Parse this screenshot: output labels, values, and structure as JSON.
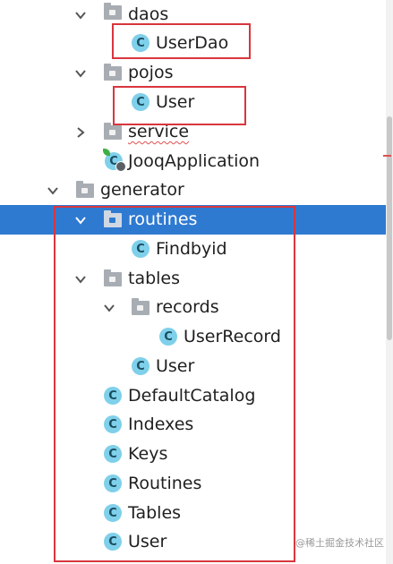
{
  "tree": {
    "daos": "daos",
    "userdao": "UserDao",
    "pojos": "pojos",
    "user_pojo": "User",
    "service": "service",
    "jooq_app": "JooqApplication",
    "generator": "generator",
    "routines_folder": "routines",
    "findbyid": "Findbyid",
    "tables_folder": "tables",
    "records": "records",
    "userrecord": "UserRecord",
    "user_table": "User",
    "default_catalog": "DefaultCatalog",
    "indexes": "Indexes",
    "keys": "Keys",
    "routines_class": "Routines",
    "tables_class": "Tables",
    "user_class": "User"
  },
  "icons": {
    "class_letter": "C",
    "expanded": "chevron-down-icon",
    "collapsed": "chevron-right-icon",
    "folder": "package-folder-icon",
    "class": "class-icon",
    "app": "spring-boot-app-icon"
  },
  "colors": {
    "selection": "#2f7ad1",
    "highlight_box": "#d9363e",
    "class_icon": "#7fd0ea"
  },
  "watermark": "@稀土掘金技术社区"
}
